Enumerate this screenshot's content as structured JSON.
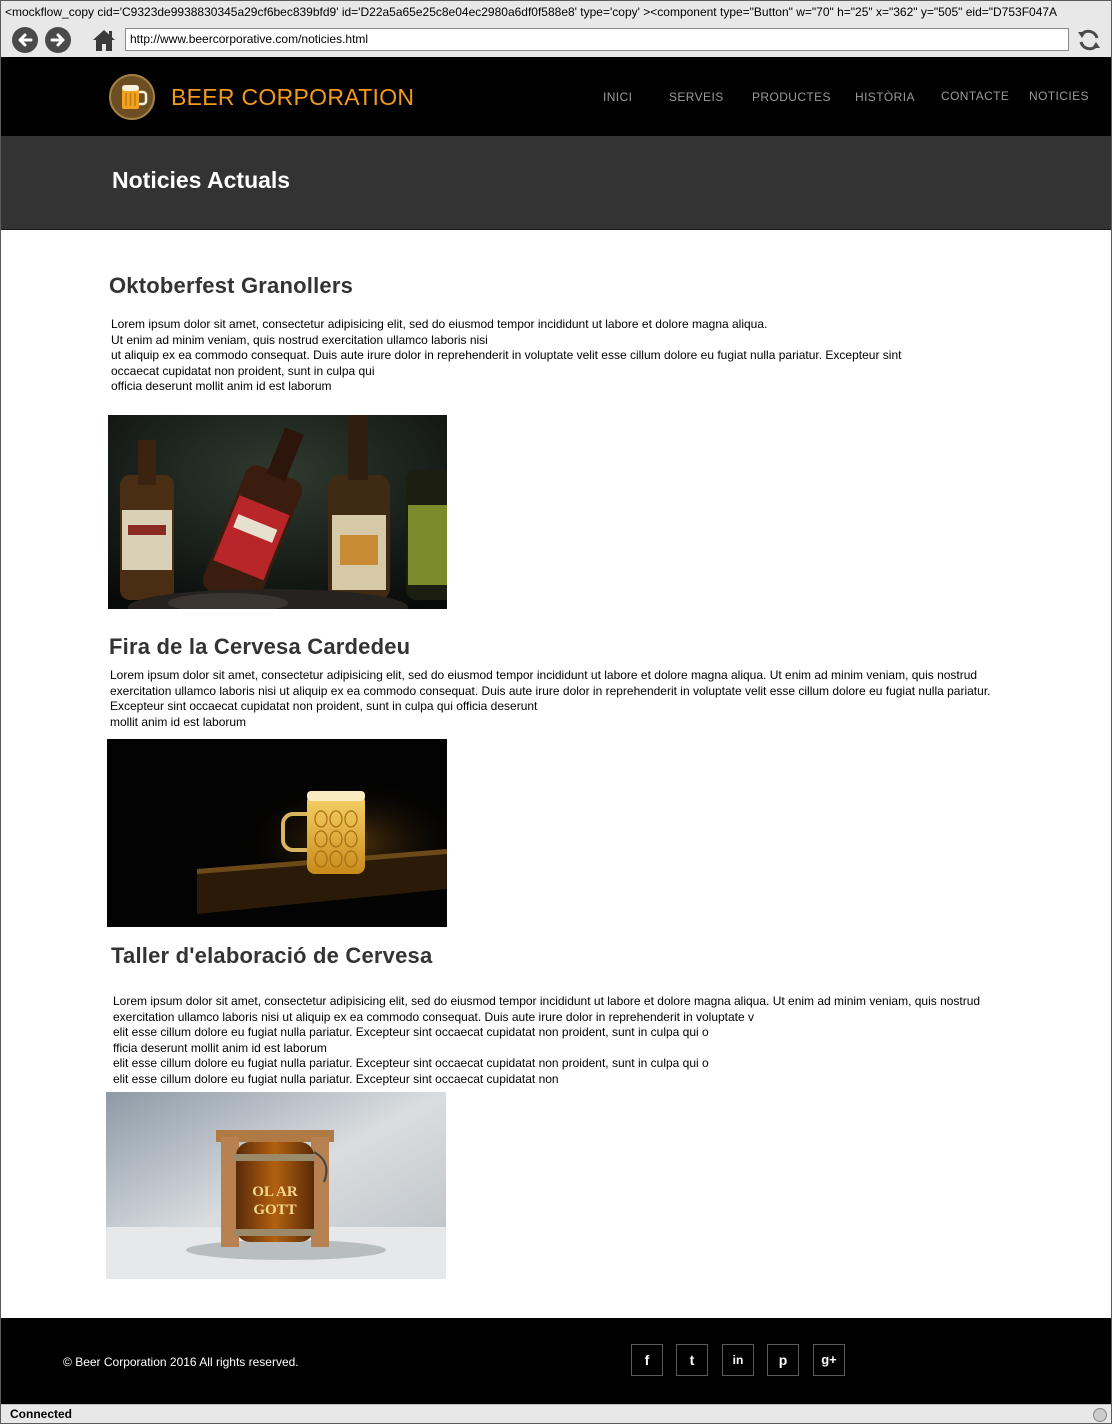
{
  "browser": {
    "title_text": "<mockflow_copy cid='C9323de9938830345a29cf6bec839bfd9' id='D22a5a65e25c8e04ec2980a6df0f588e8' type='copy' ><component type=\"Button\" w=\"70\" h=\"25\" x=\"362\" y=\"505\" eid=\"D753F047A",
    "url": "http://www.beercorporative.com/noticies.html",
    "status": "Connected",
    "back_icon": "back-arrow-icon",
    "forward_icon": "forward-arrow-icon",
    "home_icon": "home-icon",
    "reload_icon": "reload-icon"
  },
  "header": {
    "brand": "BEER CORPORATION",
    "logo_icon": "beer-mug-logo",
    "menu": [
      "INICI",
      "SERVEIS",
      "PRODUCTES",
      "HISTÒRIA",
      "CONTACTE",
      "NOTICIES"
    ]
  },
  "page": {
    "title": "Noticies Actuals"
  },
  "articles": [
    {
      "title": "Oktoberfest Granollers",
      "body": "Lorem ipsum dolor sit amet, consectetur adipisicing elit, sed do eiusmod tempor incididunt ut labore et dolore magna aliqua.\nUt enim ad minim veniam, quis nostrud exercitation ullamco laboris nisi\nut aliquip ex ea commodo consequat. Duis aute irure dolor in reprehenderit in voluptate velit esse cillum dolore eu fugiat nulla pariatur. Excepteur sint\noccaecat cupidatat non proident, sunt in culpa qui\nofficia deserunt mollit anim id est laborum",
      "image": "beer-bottles-photo"
    },
    {
      "title": "Fira de la Cervesa Cardedeu",
      "body": "Lorem ipsum dolor sit amet, consectetur adipisicing elit, sed do eiusmod tempor incididunt ut labore et dolore magna aliqua. Ut enim ad minim veniam, quis nostrud\nexercitation ullamco laboris nisi ut aliquip ex ea commodo consequat. Duis aute irure dolor in reprehenderit in voluptate velit esse cillum dolore eu fugiat nulla pariatur.\nExcepteur sint occaecat cupidatat non proident, sunt in culpa qui officia deserunt\nmollit anim id est laborum",
      "image": "beer-mug-photo"
    },
    {
      "title": "Taller d'elaboració de Cervesa",
      "body": "Lorem ipsum dolor sit amet, consectetur adipisicing elit, sed do eiusmod tempor incididunt ut labore et dolore magna aliqua. Ut enim ad minim veniam, quis nostrud\nexercitation ullamco laboris nisi ut aliquip ex ea commodo consequat. Duis aute irure dolor in reprehenderit in voluptate v\nelit esse cillum dolore eu fugiat nulla pariatur. Excepteur sint occaecat cupidatat non proident, sunt in culpa qui o\nfficia deserunt mollit anim id est laborum\nelit esse cillum dolore eu fugiat nulla pariatur. Excepteur sint occaecat cupidatat non proident, sunt in culpa qui o\nelit esse cillum dolore eu fugiat nulla pariatur. Excepteur sint occaecat cupidatat non",
      "image": "beer-keg-photo"
    }
  ],
  "footer": {
    "copyright_symbol": "©",
    "copyright": "Beer Corporation 2016 All rights reserved.",
    "social": [
      {
        "icon": "facebook-icon",
        "glyph": "f"
      },
      {
        "icon": "twitter-icon",
        "glyph": "t"
      },
      {
        "icon": "linkedin-icon",
        "glyph": "in"
      },
      {
        "icon": "pinterest-icon",
        "glyph": "p"
      },
      {
        "icon": "google-plus-icon",
        "glyph": "g+"
      }
    ]
  }
}
